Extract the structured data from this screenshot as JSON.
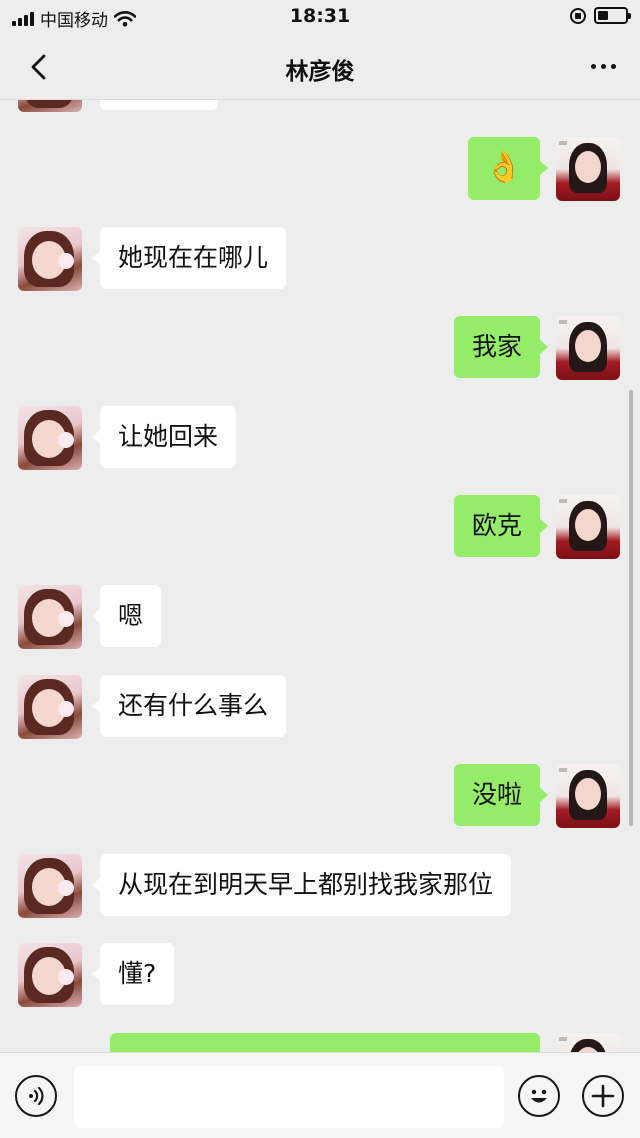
{
  "status_bar": {
    "carrier": "中国移动",
    "time": "18:31",
    "icons": [
      "signal-icon",
      "wifi-icon",
      "rotation-lock-icon",
      "battery-icon"
    ],
    "battery_level": 0.4
  },
  "nav": {
    "title": "林彦俊",
    "back_icon": "chevron-left-icon",
    "more_icon": "more-dots-icon"
  },
  "messages": [
    {
      "sender": "friend",
      "text": ""
    },
    {
      "sender": "self",
      "text": "👌"
    },
    {
      "sender": "friend",
      "text": "她现在在哪儿"
    },
    {
      "sender": "self",
      "text": "我家"
    },
    {
      "sender": "friend",
      "text": "让她回来"
    },
    {
      "sender": "self",
      "text": "欧克"
    },
    {
      "sender": "friend",
      "text": "嗯"
    },
    {
      "sender": "friend",
      "text": "还有什么事么"
    },
    {
      "sender": "self",
      "text": "没啦"
    },
    {
      "sender": "friend",
      "text": "从现在到明天早上都别找我家那位"
    },
    {
      "sender": "friend",
      "text": "懂?"
    },
    {
      "sender": "self",
      "text": ""
    }
  ],
  "input_bar": {
    "value": "",
    "icons": [
      "voice-icon",
      "emoji-icon",
      "plus-icon"
    ]
  },
  "colors": {
    "background": "#ededed",
    "self_bubble": "#95ec69",
    "friend_bubble": "#ffffff"
  }
}
